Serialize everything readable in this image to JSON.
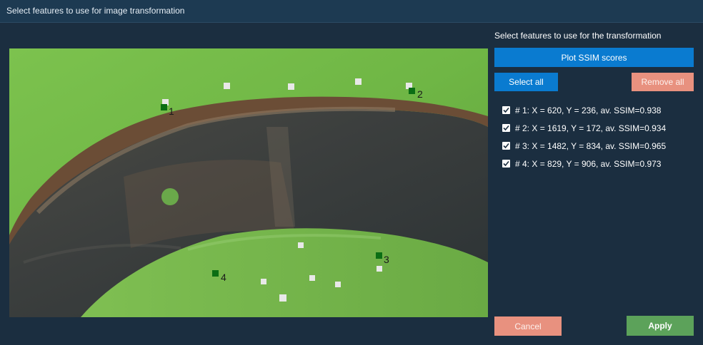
{
  "window": {
    "title": "Select features to use for image transformation"
  },
  "panel": {
    "heading": "Select features to use for the transformation",
    "plot_ssim_label": "Plot SSIM scores",
    "select_all_label": "Select all",
    "remove_all_label": "Remove all"
  },
  "features": [
    {
      "label": "# 1: X = 620, Y = 236, av. SSIM=0.938",
      "checked": true
    },
    {
      "label": "# 2: X = 1619, Y = 172, av. SSIM=0.934",
      "checked": true
    },
    {
      "label": "# 3: X = 1482, Y = 834, av. SSIM=0.965",
      "checked": true
    },
    {
      "label": "# 4: X = 829, Y = 906, av. SSIM=0.973",
      "checked": true
    }
  ],
  "markers": [
    "1",
    "2",
    "3",
    "4"
  ],
  "footer": {
    "cancel_label": "Cancel",
    "apply_label": "Apply"
  },
  "colors": {
    "accent_blue": "#0a7bd0",
    "salmon": "#e8917f",
    "apply_green": "#5ca25a",
    "marker_green": "#0b6e14",
    "background": "#1b2e40"
  }
}
